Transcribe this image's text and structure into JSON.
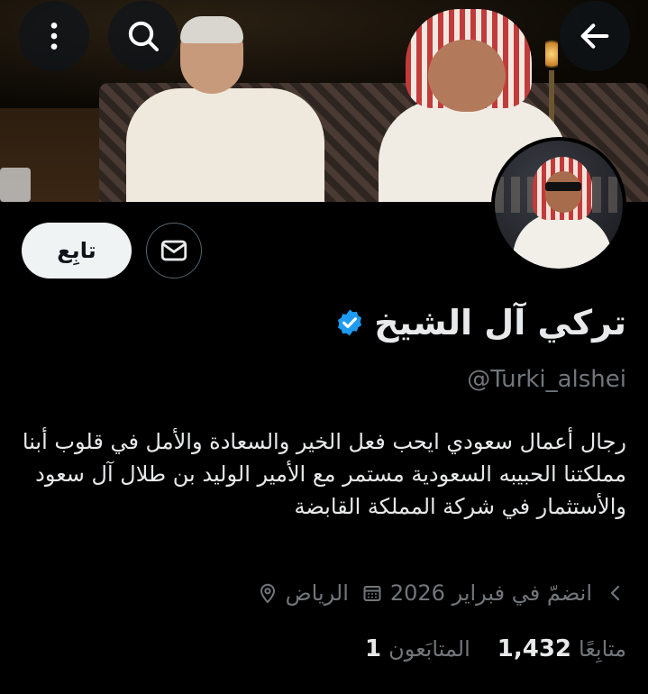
{
  "header": {
    "back_icon": "arrow-left-icon",
    "search_icon": "search-icon",
    "more_icon": "more-vertical-icon"
  },
  "profile": {
    "name": "تركي آل الشيخ",
    "verified": true,
    "verified_color": "#1d9bf0",
    "handle": "@Turki_alshei",
    "bio": "رجال أعمال سعودي ايحب فعل الخير والسعادة والأمل في قلوب أبنا مملكتنا الحبيبه السعودية مستمر مع الأمير الوليد بن طلال آل سعود والأستثمار في شركة المملكة القابضة",
    "location": "الرياض",
    "joined": "انضمّ في فبراير 2026",
    "followers_count": "1",
    "followers_label": "المتابَعون",
    "following_count": "1,432",
    "following_label": "متابِعًا"
  },
  "actions": {
    "follow_label": "تابِع",
    "message_icon": "mail-icon"
  },
  "colors": {
    "background": "#000000",
    "text_primary": "#e7e9ea",
    "text_secondary": "#71767b",
    "follow_bg": "#eff3f4"
  }
}
